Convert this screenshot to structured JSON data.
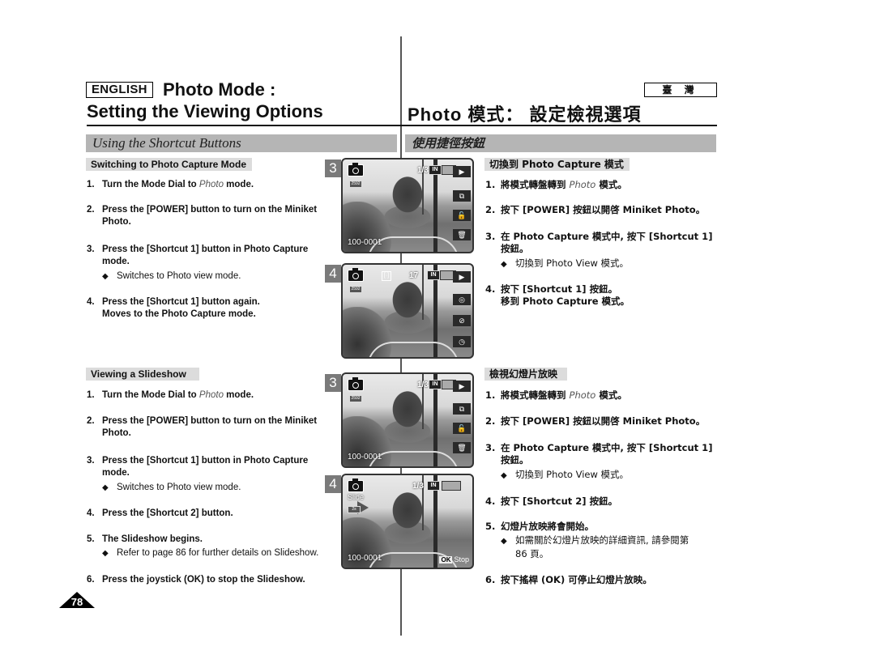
{
  "header": {
    "language_badge": "ENGLISH",
    "title_line1": "Photo Mode :",
    "title_line2": "Setting the Viewing Options",
    "region_badge": "臺 灣",
    "title_zh": "Photo 模式： 設定檢視選項"
  },
  "section": {
    "title_en": "Using the Shortcut Buttons",
    "title_zh": "使用捷徑按鈕"
  },
  "en": {
    "part1": {
      "subheading": "Switching to Photo Capture Mode",
      "steps": [
        {
          "num": "1.",
          "pre": "Turn the Mode Dial to ",
          "ital": "Photo",
          "post": " mode."
        },
        {
          "num": "2.",
          "text": "Press the [POWER] button to turn on the Miniket",
          "cont": "Photo."
        },
        {
          "num": "3.",
          "text": "Press the [Shortcut 1] button in Photo Capture",
          "cont": "mode.",
          "note": "Switches to Photo view mode."
        },
        {
          "num": "4.",
          "text": "Press the [Shortcut 1] button again.",
          "cont": "Moves to the Photo Capture mode."
        }
      ]
    },
    "part2": {
      "subheading": "Viewing a Slideshow",
      "steps": [
        {
          "num": "1.",
          "pre": "Turn the Mode Dial to ",
          "ital": "Photo",
          "post": " mode."
        },
        {
          "num": "2.",
          "text": "Press the [POWER] button to turn on the Miniket",
          "cont": "Photo."
        },
        {
          "num": "3.",
          "text": "Press the [Shortcut 1] button in Photo Capture",
          "cont": "mode.",
          "note": "Switches to Photo view mode."
        },
        {
          "num": "4.",
          "text": "Press the [Shortcut 2] button."
        },
        {
          "num": "5.",
          "text": "The Slideshow begins.",
          "note": "Refer to page 86 for further details on Slideshow."
        },
        {
          "num": "6.",
          "text": "Press the joystick (OK) to stop the Slideshow."
        }
      ]
    }
  },
  "zh": {
    "part1": {
      "subheading": "切換到 Photo Capture 模式",
      "steps": [
        {
          "num": "1.",
          "pre": "將模式轉盤轉到 ",
          "ital": "Photo",
          "post": " 模式。"
        },
        {
          "num": "2.",
          "text": "按下 [POWER] 按鈕以開啓 Miniket Photo。"
        },
        {
          "num": "3.",
          "text": "在 Photo Capture 模式中, 按下 [Shortcut 1]",
          "cont": "按鈕。",
          "note": "切換到 Photo View 模式。"
        },
        {
          "num": "4.",
          "text": "按下 [Shortcut 1] 按鈕。",
          "cont": "移到 Photo Capture 模式。"
        }
      ]
    },
    "part2": {
      "subheading": "檢視幻燈片放映",
      "steps": [
        {
          "num": "1.",
          "pre": "將模式轉盤轉到 ",
          "ital": "Photo",
          "post": " 模式。"
        },
        {
          "num": "2.",
          "text": "按下 [POWER] 按鈕以開啓 Miniket Photo。"
        },
        {
          "num": "3.",
          "text": "在 Photo Capture 模式中, 按下 [Shortcut 1]",
          "cont": "按鈕。",
          "note": "切換到 Photo View 模式。"
        },
        {
          "num": "4.",
          "text": "按下 [Shortcut 2] 按鈕。"
        },
        {
          "num": "5.",
          "text": "幻燈片放映將會開始。",
          "note": "如需關於幻燈片放映的詳細資訊, 請參閱第",
          "note_cont": "86 頁。"
        },
        {
          "num": "6.",
          "text": "按下搖桿 (OK) 可停止幻燈片放映。"
        }
      ]
    }
  },
  "screens": [
    {
      "step": "3",
      "file_no": "100-0001",
      "count": "1/3",
      "memory": "IN",
      "res": "2592",
      "buttons": [
        "▶",
        "⧉",
        "🔓",
        "🗑"
      ],
      "icons": [
        "play-icon",
        "copy-icon",
        "unlock-icon",
        "trash-icon"
      ]
    },
    {
      "step": "4",
      "count": "17",
      "memory": "IN",
      "res": "2592",
      "focus": "[·]",
      "buttons": [
        "▶",
        "◎",
        "⊘",
        "◷"
      ],
      "icons": [
        "play-icon",
        "eye-icon",
        "flash-off-icon",
        "timer-icon"
      ]
    },
    {
      "step": "3",
      "file_no": "100-0001",
      "count": "1/3",
      "memory": "IN",
      "res": "2592",
      "buttons": [
        "▶",
        "⧉",
        "🔓",
        "🗑"
      ],
      "icons": [
        "play-icon",
        "copy-icon",
        "unlock-icon",
        "trash-icon"
      ]
    },
    {
      "step": "4",
      "file_no": "100-0001",
      "count": "1/3",
      "memory": "IN",
      "slide_label": "Slide",
      "slide_interval": "2s",
      "ok_label": "OK",
      "stop_label": "Stop"
    }
  ],
  "page_number": "78"
}
